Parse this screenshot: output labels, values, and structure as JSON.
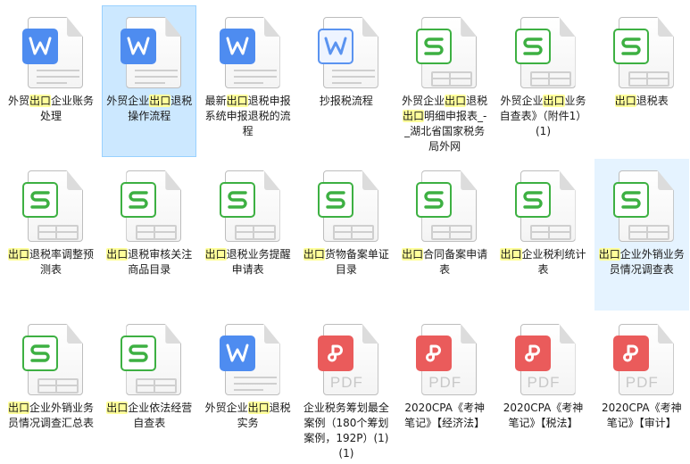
{
  "highlight_term": "出口",
  "colors": {
    "word": "#4e8cf0",
    "sheet": "#3db042",
    "pdf": "#ea5b5b",
    "selected": "#cce8ff",
    "hover": "#e5f3ff",
    "highlight": "#ffff8a"
  },
  "pdf_label": "PDF",
  "files": [
    {
      "name": "外贸出口企业账务处理",
      "type": "word",
      "state": ""
    },
    {
      "name": "外贸企业出口退税操作流程",
      "type": "word",
      "state": "selected"
    },
    {
      "name": "最新出口退税申报系统申报退税的流程",
      "type": "word",
      "state": ""
    },
    {
      "name": "抄报税流程",
      "type": "word-outline",
      "state": ""
    },
    {
      "name": "外贸企业出口退税出口明细申报表_-_湖北省国家税务局外网",
      "type": "sheet",
      "state": ""
    },
    {
      "name": "外贸企业出口业务自查表》（附件1）(1)",
      "type": "sheet",
      "state": ""
    },
    {
      "name": "出口退税表",
      "type": "sheet",
      "state": ""
    },
    {
      "name": "出口退税率调整预测表",
      "type": "sheet",
      "state": ""
    },
    {
      "name": "出口退税审核关注商品目录",
      "type": "sheet",
      "state": ""
    },
    {
      "name": "出口退税业务提醒申请表",
      "type": "sheet",
      "state": ""
    },
    {
      "name": "出口货物备案单证目录",
      "type": "sheet",
      "state": ""
    },
    {
      "name": "出口合同备案申请表",
      "type": "sheet",
      "state": ""
    },
    {
      "name": "出口企业税利统计表",
      "type": "sheet",
      "state": ""
    },
    {
      "name": "出口企业外销业务员情况调查表",
      "type": "sheet",
      "state": "hover"
    },
    {
      "name": "出口企业外销业务员情况调查汇总表",
      "type": "sheet",
      "state": ""
    },
    {
      "name": "出口企业依法经营自查表",
      "type": "sheet",
      "state": ""
    },
    {
      "name": "外贸企业出口退税实务",
      "type": "word",
      "state": ""
    },
    {
      "name": "企业税务筹划最全案例（180个筹划案例，192P）(1)(1)",
      "type": "pdf",
      "state": ""
    },
    {
      "name": "2020CPA《考神笔记》【经济法】",
      "type": "pdf",
      "state": ""
    },
    {
      "name": "2020CPA《考神笔记》【税法】",
      "type": "pdf",
      "state": ""
    },
    {
      "name": "2020CPA《考神笔记》【审计】",
      "type": "pdf",
      "state": ""
    }
  ]
}
